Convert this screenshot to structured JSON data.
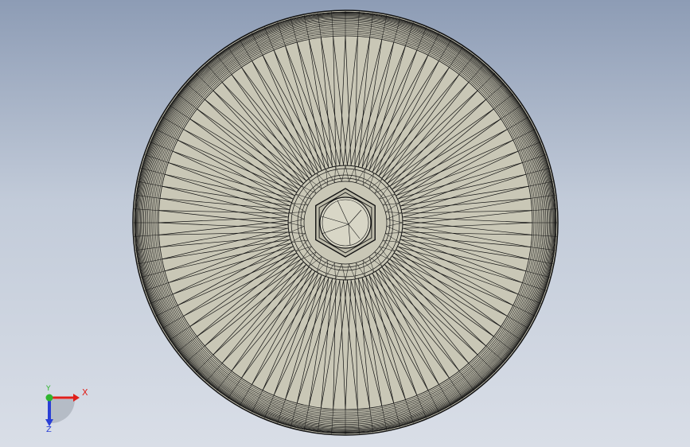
{
  "triad": {
    "x_label": "X",
    "y_label": "Y",
    "z_label": "Z"
  },
  "colors": {
    "face": "#c9c7b6",
    "edge": "#111111",
    "x_axis": "#e0201b",
    "y_axis": "#2fb52f",
    "z_axis": "#2a3fd6"
  }
}
